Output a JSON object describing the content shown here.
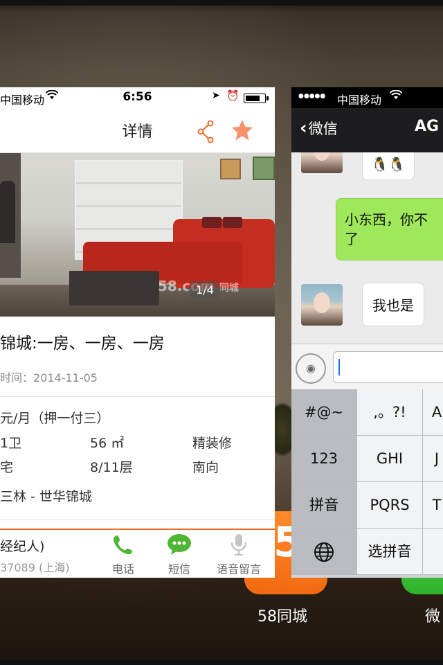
{
  "left_card": {
    "status": {
      "carrier": "中国移动",
      "time": "6:56"
    },
    "nav": {
      "title": "详情"
    },
    "photo": {
      "counter": "1/4",
      "watermark": "58.com",
      "watermark_brand": "同城"
    },
    "headline": "锦城:一房、一房、一房",
    "posted": "时间：2014-11-05",
    "price": "元/月（押一付三）",
    "attrs": [
      [
        "1卫",
        "56 ㎡",
        "精装修"
      ],
      [
        "宅",
        "8/11层",
        "南向"
      ]
    ],
    "location": "三林 - 世华锦城",
    "agent": {
      "name": "经纪人)",
      "phone": "37089 (上海)"
    },
    "actions": [
      {
        "label": "电话",
        "icon": "phone-icon"
      },
      {
        "label": "短信",
        "icon": "sms-icon"
      },
      {
        "label": "语音留言",
        "icon": "microphone-icon"
      }
    ],
    "colors": {
      "accent": "#f06a2b",
      "green": "#4fb534"
    }
  },
  "right_card": {
    "status": {
      "carrier": "中国移动"
    },
    "nav": {
      "back_label": "微信",
      "title": "AG"
    },
    "messages": [
      {
        "side": "left",
        "text": "🐧🐧"
      },
      {
        "side": "right",
        "text": "小东西，你不\n了"
      },
      {
        "side": "left",
        "text": "我也是"
      }
    ],
    "keyboard": {
      "rows": [
        [
          "#@~",
          ",。?!",
          "A"
        ],
        [
          "123",
          "GHI",
          "J"
        ],
        [
          "拼音",
          "PQRS",
          "T"
        ],
        [
          "globe",
          "选拼音",
          ""
        ]
      ]
    }
  },
  "dock": [
    {
      "label": "58同城",
      "icon": "58-app-icon"
    },
    {
      "label": "微",
      "icon": "wechat-app-icon"
    }
  ]
}
